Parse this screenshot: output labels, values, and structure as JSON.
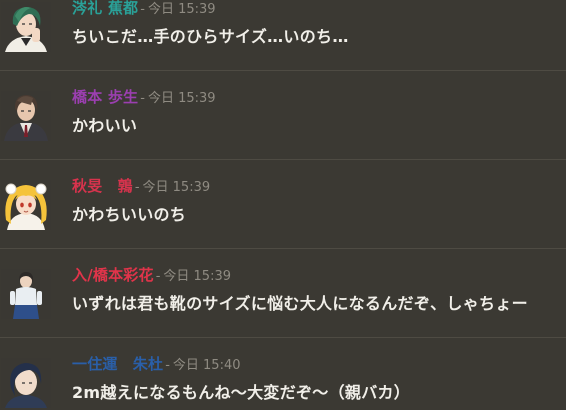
{
  "messages": [
    {
      "speaker": "涔礼 蕉都",
      "speaker_color": "#2aa198",
      "separator": "-",
      "timestamp": "今日 15:39",
      "text": "ちいこだ…手のひらサイズ…いのち…",
      "avatar_icon": "green-haired-man-avatar"
    },
    {
      "speaker": "橋本 歩生",
      "speaker_color": "#9b3fb0",
      "separator": "-",
      "timestamp": "今日 15:39",
      "text": "かわいい",
      "avatar_icon": "suited-man-avatar"
    },
    {
      "speaker": "秋旻　鶉",
      "speaker_color": "#d7334d",
      "separator": "-",
      "timestamp": "今日 15:39",
      "text": "かわちいいのち",
      "avatar_icon": "blonde-girl-avatar"
    },
    {
      "speaker": "入/橋本彩花",
      "speaker_color": "#e0344a",
      "separator": "-",
      "timestamp": "今日 15:39",
      "text": "いずれは君も靴のサイズに悩む大人になるんだぞ、しゃちょー",
      "avatar_icon": "standing-woman-avatar"
    },
    {
      "speaker": "一住運　朱杜",
      "speaker_color": "#2a5fa8",
      "separator": "-",
      "timestamp": "今日 15:40",
      "text": "2m越えになるもんね〜大変だぞ〜（親バカ）",
      "avatar_icon": "dark-haired-man-avatar"
    }
  ]
}
